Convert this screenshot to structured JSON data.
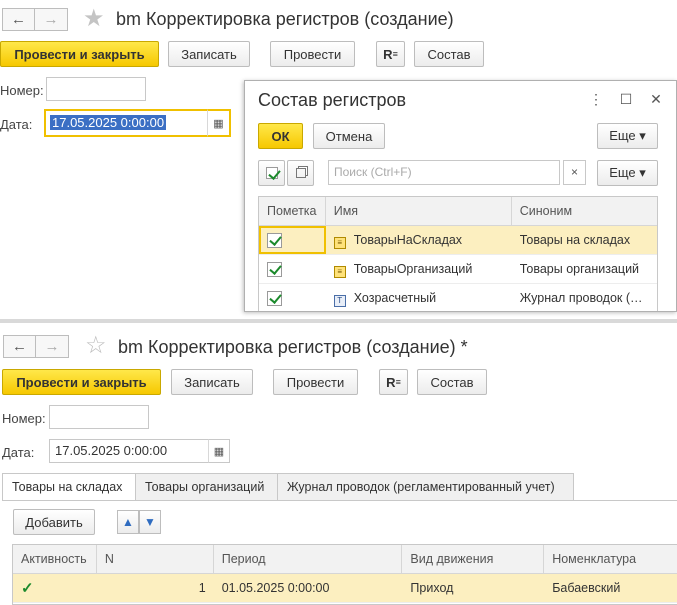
{
  "top": {
    "nav_back": "←",
    "nav_forward": "→",
    "star": "★",
    "title": "bm Корректировка регистров (создание)",
    "buttons": {
      "post_close": "Провести и закрыть",
      "write": "Записать",
      "post": "Провести",
      "report": "R",
      "composition": "Состав"
    },
    "number_label": "Номер:",
    "number_value": "",
    "date_label": "Дата:",
    "date_value": "17.05.2025  0:00:00",
    "calendar_icon": "▦"
  },
  "dialog": {
    "title": "Состав регистров",
    "controls": {
      "more": "⋮",
      "maximize": "☐",
      "close": "✕"
    },
    "ok_label": "ОК",
    "cancel_label": "Отмена",
    "more_label": "Еще ▾",
    "search_placeholder": "Поиск (Ctrl+F)",
    "search_clear": "×",
    "more2_label": "Еще ▾",
    "columns": [
      "Пометка",
      "Имя",
      "Синоним"
    ],
    "rows": [
      {
        "checked": true,
        "icon": "register-icon",
        "name": "ТоварыНаСкладах",
        "synonym": "Товары на складах"
      },
      {
        "checked": true,
        "icon": "register-icon",
        "name": "ТоварыОрганизаций",
        "synonym": "Товары организаций"
      },
      {
        "checked": true,
        "icon": "accounting-register-icon",
        "name": "Хозрасчетный",
        "synonym": "Журнал проводок (…"
      }
    ]
  },
  "bottom": {
    "nav_back": "←",
    "nav_forward": "→",
    "star": "☆",
    "title": "bm Корректировка регистров (создание) *",
    "buttons": {
      "post_close": "Провести и закрыть",
      "write": "Записать",
      "post": "Провести",
      "report": "R",
      "composition": "Состав"
    },
    "number_label": "Номер:",
    "number_value": "",
    "date_label": "Дата:",
    "date_value": "17.05.2025  0:00:00",
    "calendar_icon": "▦",
    "tabs": [
      "Товары на складах",
      "Товары организаций",
      "Журнал проводок (регламентированный учет)"
    ],
    "add_label": "Добавить",
    "up_icon": "▲",
    "down_icon": "▼",
    "columns": [
      "Активность",
      "N",
      "Период",
      "Вид движения",
      "Номенклатура"
    ],
    "rows": [
      {
        "active": "✓",
        "n": "1",
        "period": "01.05.2025 0:00:00",
        "movement": "Приход",
        "item": "Бабаевский"
      }
    ]
  }
}
